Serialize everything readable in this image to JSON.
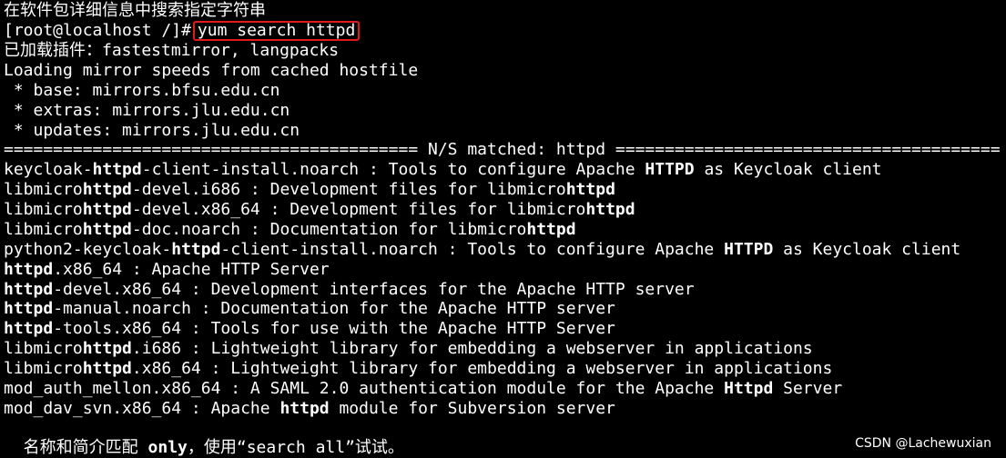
{
  "terminal": {
    "heading": "在软件包详细信息中搜索指定字符串",
    "prompt": "[root@localhost /]#",
    "command": "yum search httpd",
    "plugins": "已加载插件：fastestmirror, langpacks",
    "mirror_loading": "Loading mirror speeds from cached hostfile",
    "mirrors": [
      " * base: mirrors.bfsu.edu.cn",
      " * extras: mirrors.jlu.edu.cn",
      " * updates: mirrors.jlu.edu.cn"
    ],
    "separator": "========================================== N/S matched: httpd =======================================",
    "results": [
      [
        {
          "t": "keycloak-"
        },
        {
          "t": "httpd",
          "b": true
        },
        {
          "t": "-client-install.noarch : Tools to configure Apache "
        },
        {
          "t": "HTTPD",
          "b": true
        },
        {
          "t": " as Keycloak client"
        }
      ],
      [
        {
          "t": "libmicro"
        },
        {
          "t": "httpd",
          "b": true
        },
        {
          "t": "-devel.i686 : Development files for libmicro"
        },
        {
          "t": "httpd",
          "b": true
        }
      ],
      [
        {
          "t": "libmicro"
        },
        {
          "t": "httpd",
          "b": true
        },
        {
          "t": "-devel.x86_64 : Development files for libmicro"
        },
        {
          "t": "httpd",
          "b": true
        }
      ],
      [
        {
          "t": "libmicro"
        },
        {
          "t": "httpd",
          "b": true
        },
        {
          "t": "-doc.noarch : Documentation for libmicro"
        },
        {
          "t": "httpd",
          "b": true
        }
      ],
      [
        {
          "t": "python2-keycloak-"
        },
        {
          "t": "httpd",
          "b": true
        },
        {
          "t": "-client-install.noarch : Tools to configure Apache "
        },
        {
          "t": "HTTPD",
          "b": true
        },
        {
          "t": " as Keycloak client"
        }
      ],
      [
        {
          "t": "httpd",
          "b": true
        },
        {
          "t": ".x86_64 : Apache HTTP Server"
        }
      ],
      [
        {
          "t": "httpd",
          "b": true
        },
        {
          "t": "-devel.x86_64 : Development interfaces for the Apache HTTP server"
        }
      ],
      [
        {
          "t": "httpd",
          "b": true
        },
        {
          "t": "-manual.noarch : Documentation for the Apache HTTP server"
        }
      ],
      [
        {
          "t": "httpd",
          "b": true
        },
        {
          "t": "-tools.x86_64 : Tools for use with the Apache HTTP Server"
        }
      ],
      [
        {
          "t": "libmicro"
        },
        {
          "t": "httpd",
          "b": true
        },
        {
          "t": ".i686 : Lightweight library for embedding a webserver in applications"
        }
      ],
      [
        {
          "t": "libmicro"
        },
        {
          "t": "httpd",
          "b": true
        },
        {
          "t": ".x86_64 : Lightweight library for embedding a webserver in applications"
        }
      ],
      [
        {
          "t": "mod_auth_mellon.x86_64 : A SAML 2.0 authentication module for the Apache "
        },
        {
          "t": "Httpd",
          "b": true
        },
        {
          "t": " Server"
        }
      ],
      [
        {
          "t": "mod_dav_svn.x86_64 : Apache "
        },
        {
          "t": "httpd",
          "b": true
        },
        {
          "t": " module for Subversion server"
        }
      ]
    ],
    "footer": [
      {
        "t": "  名称和简介匹配 "
      },
      {
        "t": "only",
        "b": true
      },
      {
        "t": "，使用“search all”试试。"
      }
    ]
  },
  "watermark": "CSDN @Lachewuxian",
  "colors": {
    "background": "#000000",
    "text": "#ffffff",
    "highlight_box": "#e4191c"
  }
}
